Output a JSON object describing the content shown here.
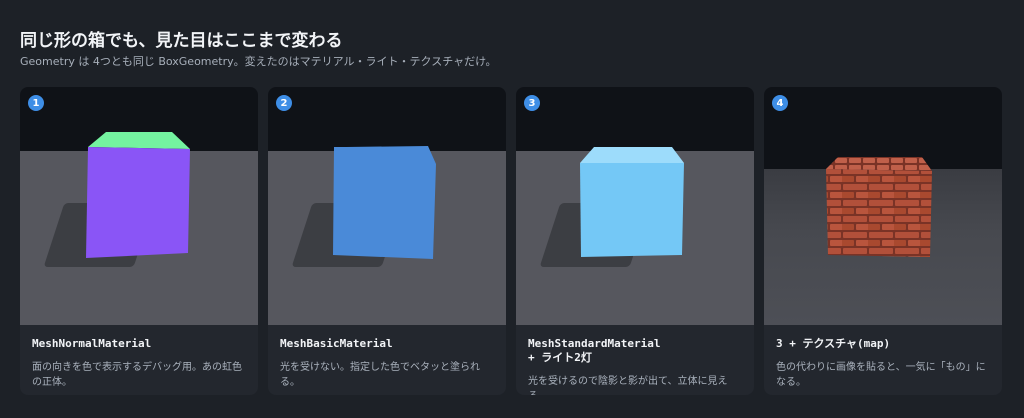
{
  "header": {
    "title": "同じ形の箱でも、見た目はここまで変わる",
    "subtitle": "Geometry は 4つとも同じ BoxGeometry。変えたのはマテリアル・ライト・テクスチャだけ。"
  },
  "cards": [
    {
      "badge": "1",
      "name": "MeshNormalMaterial",
      "name_line2": "",
      "description": "面の向きを色で表示するデバッグ用。あの虹色の正体。",
      "colors": {
        "front": "#8a55f6",
        "top": "#74f3a0",
        "side": "#2a6fe8"
      }
    },
    {
      "badge": "2",
      "name": "MeshBasicMaterial",
      "name_line2": "",
      "description": "光を受けない。指定した色でベタッと塗られる。",
      "colors": {
        "front": "#4a8ad8",
        "top": "#4a8ad8",
        "side": "#4a8ad8"
      }
    },
    {
      "badge": "3",
      "name": "MeshStandardMaterial",
      "name_line2": "+ ライト2灯",
      "description": "光を受けるので陰影と影が出て、立体に見える。",
      "colors": {
        "front": "#74c8f6",
        "top": "#9ddcfb",
        "side": "#5fb3e6"
      }
    },
    {
      "badge": "4",
      "name": "3 + テクスチャ(map)",
      "name_line2": "",
      "description": "色の代わりに画像を貼ると、一気に「もの」になる。",
      "colors": {
        "front": "#b2503a",
        "top": "#c0604a",
        "mortar": "#7a3326"
      }
    }
  ]
}
